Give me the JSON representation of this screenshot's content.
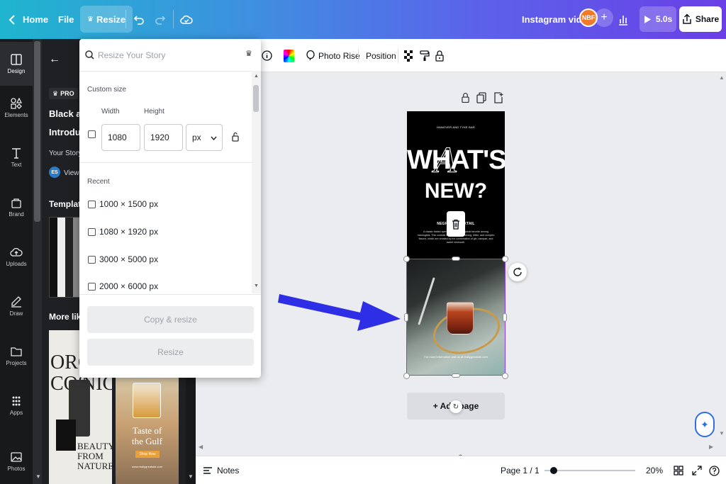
{
  "topbar": {
    "home_label": "Home",
    "file_label": "File",
    "resize_label": "Resize",
    "doc_title": "Instagram vido",
    "avatar_initials": "NBF",
    "duration_label": "5.0s",
    "share_label": "Share"
  },
  "rail": {
    "items": [
      {
        "label": "Design",
        "icon": "design-icon"
      },
      {
        "label": "Elements",
        "icon": "elements-icon"
      },
      {
        "label": "Text",
        "icon": "text-icon"
      },
      {
        "label": "Brand",
        "icon": "brand-icon"
      },
      {
        "label": "Uploads",
        "icon": "uploads-icon"
      },
      {
        "label": "Draw",
        "icon": "draw-icon"
      },
      {
        "label": "Projects",
        "icon": "projects-icon"
      },
      {
        "label": "Apps",
        "icon": "apps-icon"
      },
      {
        "label": "Photos",
        "icon": "photos-icon"
      }
    ]
  },
  "sidepanel": {
    "pro_label": "PRO",
    "title_line1": "Black and",
    "title_line2": "Introduc",
    "subtitle": "Your Story",
    "author_initials": "ES",
    "view_label": "View n",
    "template_heading": "Template",
    "more_like_heading": "More like t",
    "card1_text1": "ORG",
    "card1_text2": "COS",
    "card1_text3": "NICS",
    "card1_text4": "BEAUTY",
    "card1_text5": "FROM",
    "card1_text6": "NATURE",
    "card2_text1": "Taste of",
    "card2_text2": "the Gulf",
    "card2_text3": "Shop Now",
    "card2_text4": "www.reallygreatsite.com"
  },
  "resize_dropdown": {
    "search_placeholder": "Resize Your Story",
    "custom_size_label": "Custom size",
    "width_label": "Width",
    "height_label": "Height",
    "width_value": "1080",
    "height_value": "1920",
    "unit_value": "px",
    "recent_label": "Recent",
    "recent_items": [
      "1000 × 1500 px",
      "1080 × 1920 px",
      "3000 × 5000 px",
      "2000 × 6000 px"
    ],
    "copy_resize_label": "Copy & resize",
    "resize_label": "Resize"
  },
  "editor_toolbar": {
    "photo_rise_label": "Photo Rise",
    "position_label": "Position"
  },
  "design": {
    "header_small": "HANOVER AND TYKE BAR",
    "headline1": "WHAT'S",
    "headline2": "NEW?",
    "script_overlay": "A",
    "sub_heading": "NEGRONI COCKTAIL",
    "paragraph": "A classic Italian aperitif Negroni is a global favorite among mixologists. This cocktail is famous for its strong, bitter, and complex flavors, which are created by the combination of gin, campari, and sweet vermouth.",
    "footer": "For more information visit us at reallygreatsite.com"
  },
  "canvas": {
    "add_page_label": "+ Add page"
  },
  "bottombar": {
    "notes_label": "Notes",
    "page_label": "Page 1 / 1",
    "zoom_label": "20%",
    "zoom_level": 0.2
  },
  "colors": {
    "accent": "#8b3dff",
    "arrow": "#2e2ee6",
    "topbar_start": "#1fb5cf",
    "topbar_end": "#6a3fe6"
  }
}
